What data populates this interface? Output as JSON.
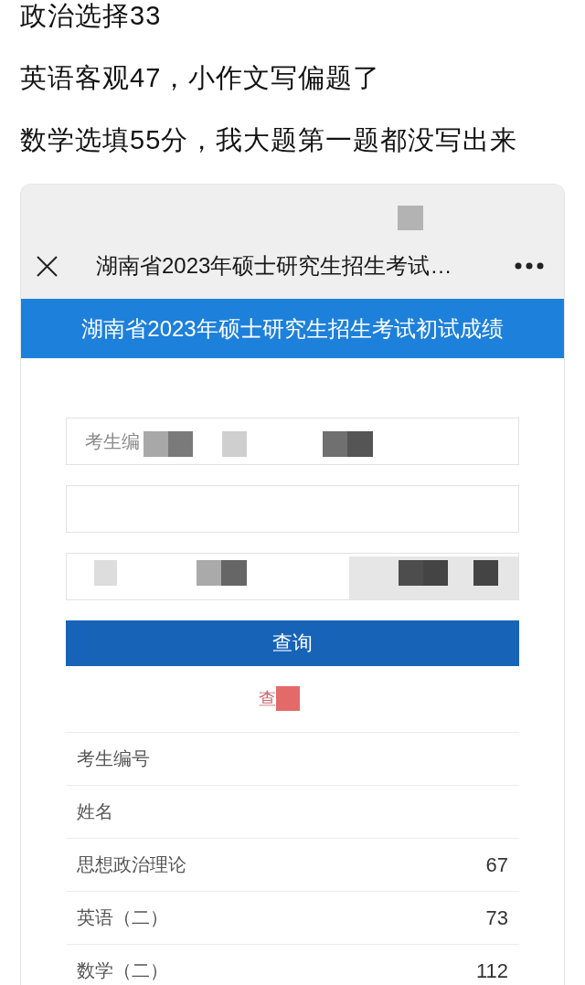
{
  "post": {
    "lines": [
      "政治选择33",
      "英语客观47，小作文写偏题了",
      "数学选填55分，我大题第一题都没写出来"
    ]
  },
  "screenshot": {
    "nav_bar": {
      "title": "湖南省2023年硕士研究生招生考试…",
      "redacted": true
    },
    "banner": {
      "title": "湖南省2023年硕士研究生招生考试初试成绩"
    },
    "form": {
      "fields": [
        {
          "placeholder": "考生编",
          "redacted": true
        },
        {
          "redacted": false
        },
        {
          "redacted": true
        }
      ],
      "button": {
        "label": "查询"
      }
    },
    "notice": {
      "text": "查",
      "redacted": true
    },
    "results": [
      {
        "label": "考生编号"
      },
      {
        "label": "姓名"
      },
      {
        "label": "思想政治理论",
        "value": "67"
      },
      {
        "label": "英语（二）",
        "value": "73"
      },
      {
        "label": "数学（二）",
        "value": "112"
      }
    ]
  }
}
